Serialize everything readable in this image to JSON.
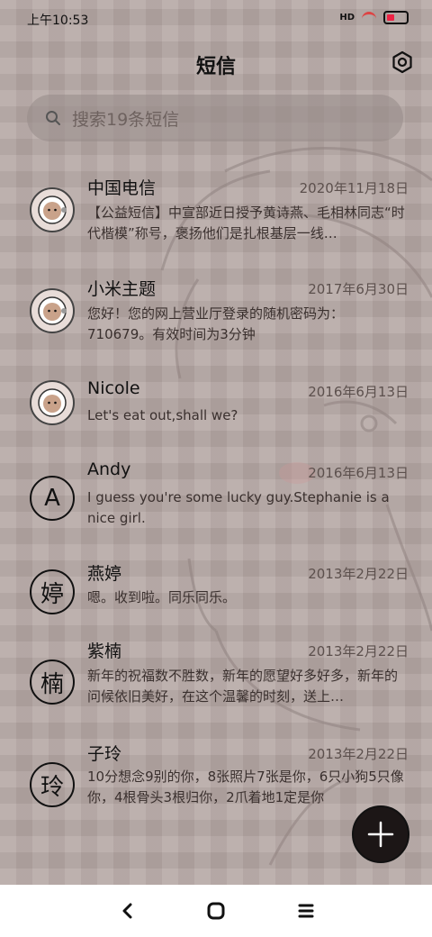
{
  "status_bar": {
    "time": "上午10:53",
    "signal": "HD"
  },
  "header": {
    "title": "短信",
    "settings_icon": "gear-icon"
  },
  "search": {
    "placeholder": "搜索19条短信",
    "icon": "search-icon"
  },
  "conversations": [
    {
      "name": "中国电信",
      "date": "2020年11月18日",
      "msg": "【公益短信】中宣部近日授予黄诗燕、毛相林同志“时代楷模”称号，褒扬他们是扎根基层一线…",
      "avatar_type": "image",
      "avatar_char": ""
    },
    {
      "name": "小米主题",
      "date": "2017年6月30日",
      "msg": "您好！您的网上营业厅登录的随机密码为：710679。有效时间为3分钟",
      "avatar_type": "image",
      "avatar_char": ""
    },
    {
      "name": "Nicole",
      "date": "2016年6月13日",
      "msg": "Let's eat out,shall we?",
      "avatar_type": "image",
      "avatar_char": ""
    },
    {
      "name": "Andy",
      "date": "2016年6月13日",
      "msg": "I guess you're some lucky guy.Stephanie is a nice girl.",
      "avatar_type": "letter",
      "avatar_char": "A"
    },
    {
      "name": "燕婷",
      "date": "2013年2月22日",
      "msg": "嗯。收到啦。同乐同乐。",
      "avatar_type": "letter",
      "avatar_char": "婷"
    },
    {
      "name": "紫楠",
      "date": "2013年2月22日",
      "msg": "新年的祝福数不胜数，新年的愿望好多好多，新年的问候依旧美好，在这个温馨的时刻，送上…",
      "avatar_type": "letter",
      "avatar_char": "楠"
    },
    {
      "name": "子玲",
      "date": "2013年2月22日",
      "msg": "10分想念9别的你，8张照片7张是你，6只小狗5只像你，4根骨头3根归你，2爪着地1定是你",
      "avatar_type": "letter",
      "avatar_char": "玲"
    }
  ],
  "fab": {
    "icon": "plus-icon"
  },
  "navbar": {
    "back_icon": "back-icon",
    "home_icon": "home-icon",
    "recents_icon": "menu-icon"
  }
}
